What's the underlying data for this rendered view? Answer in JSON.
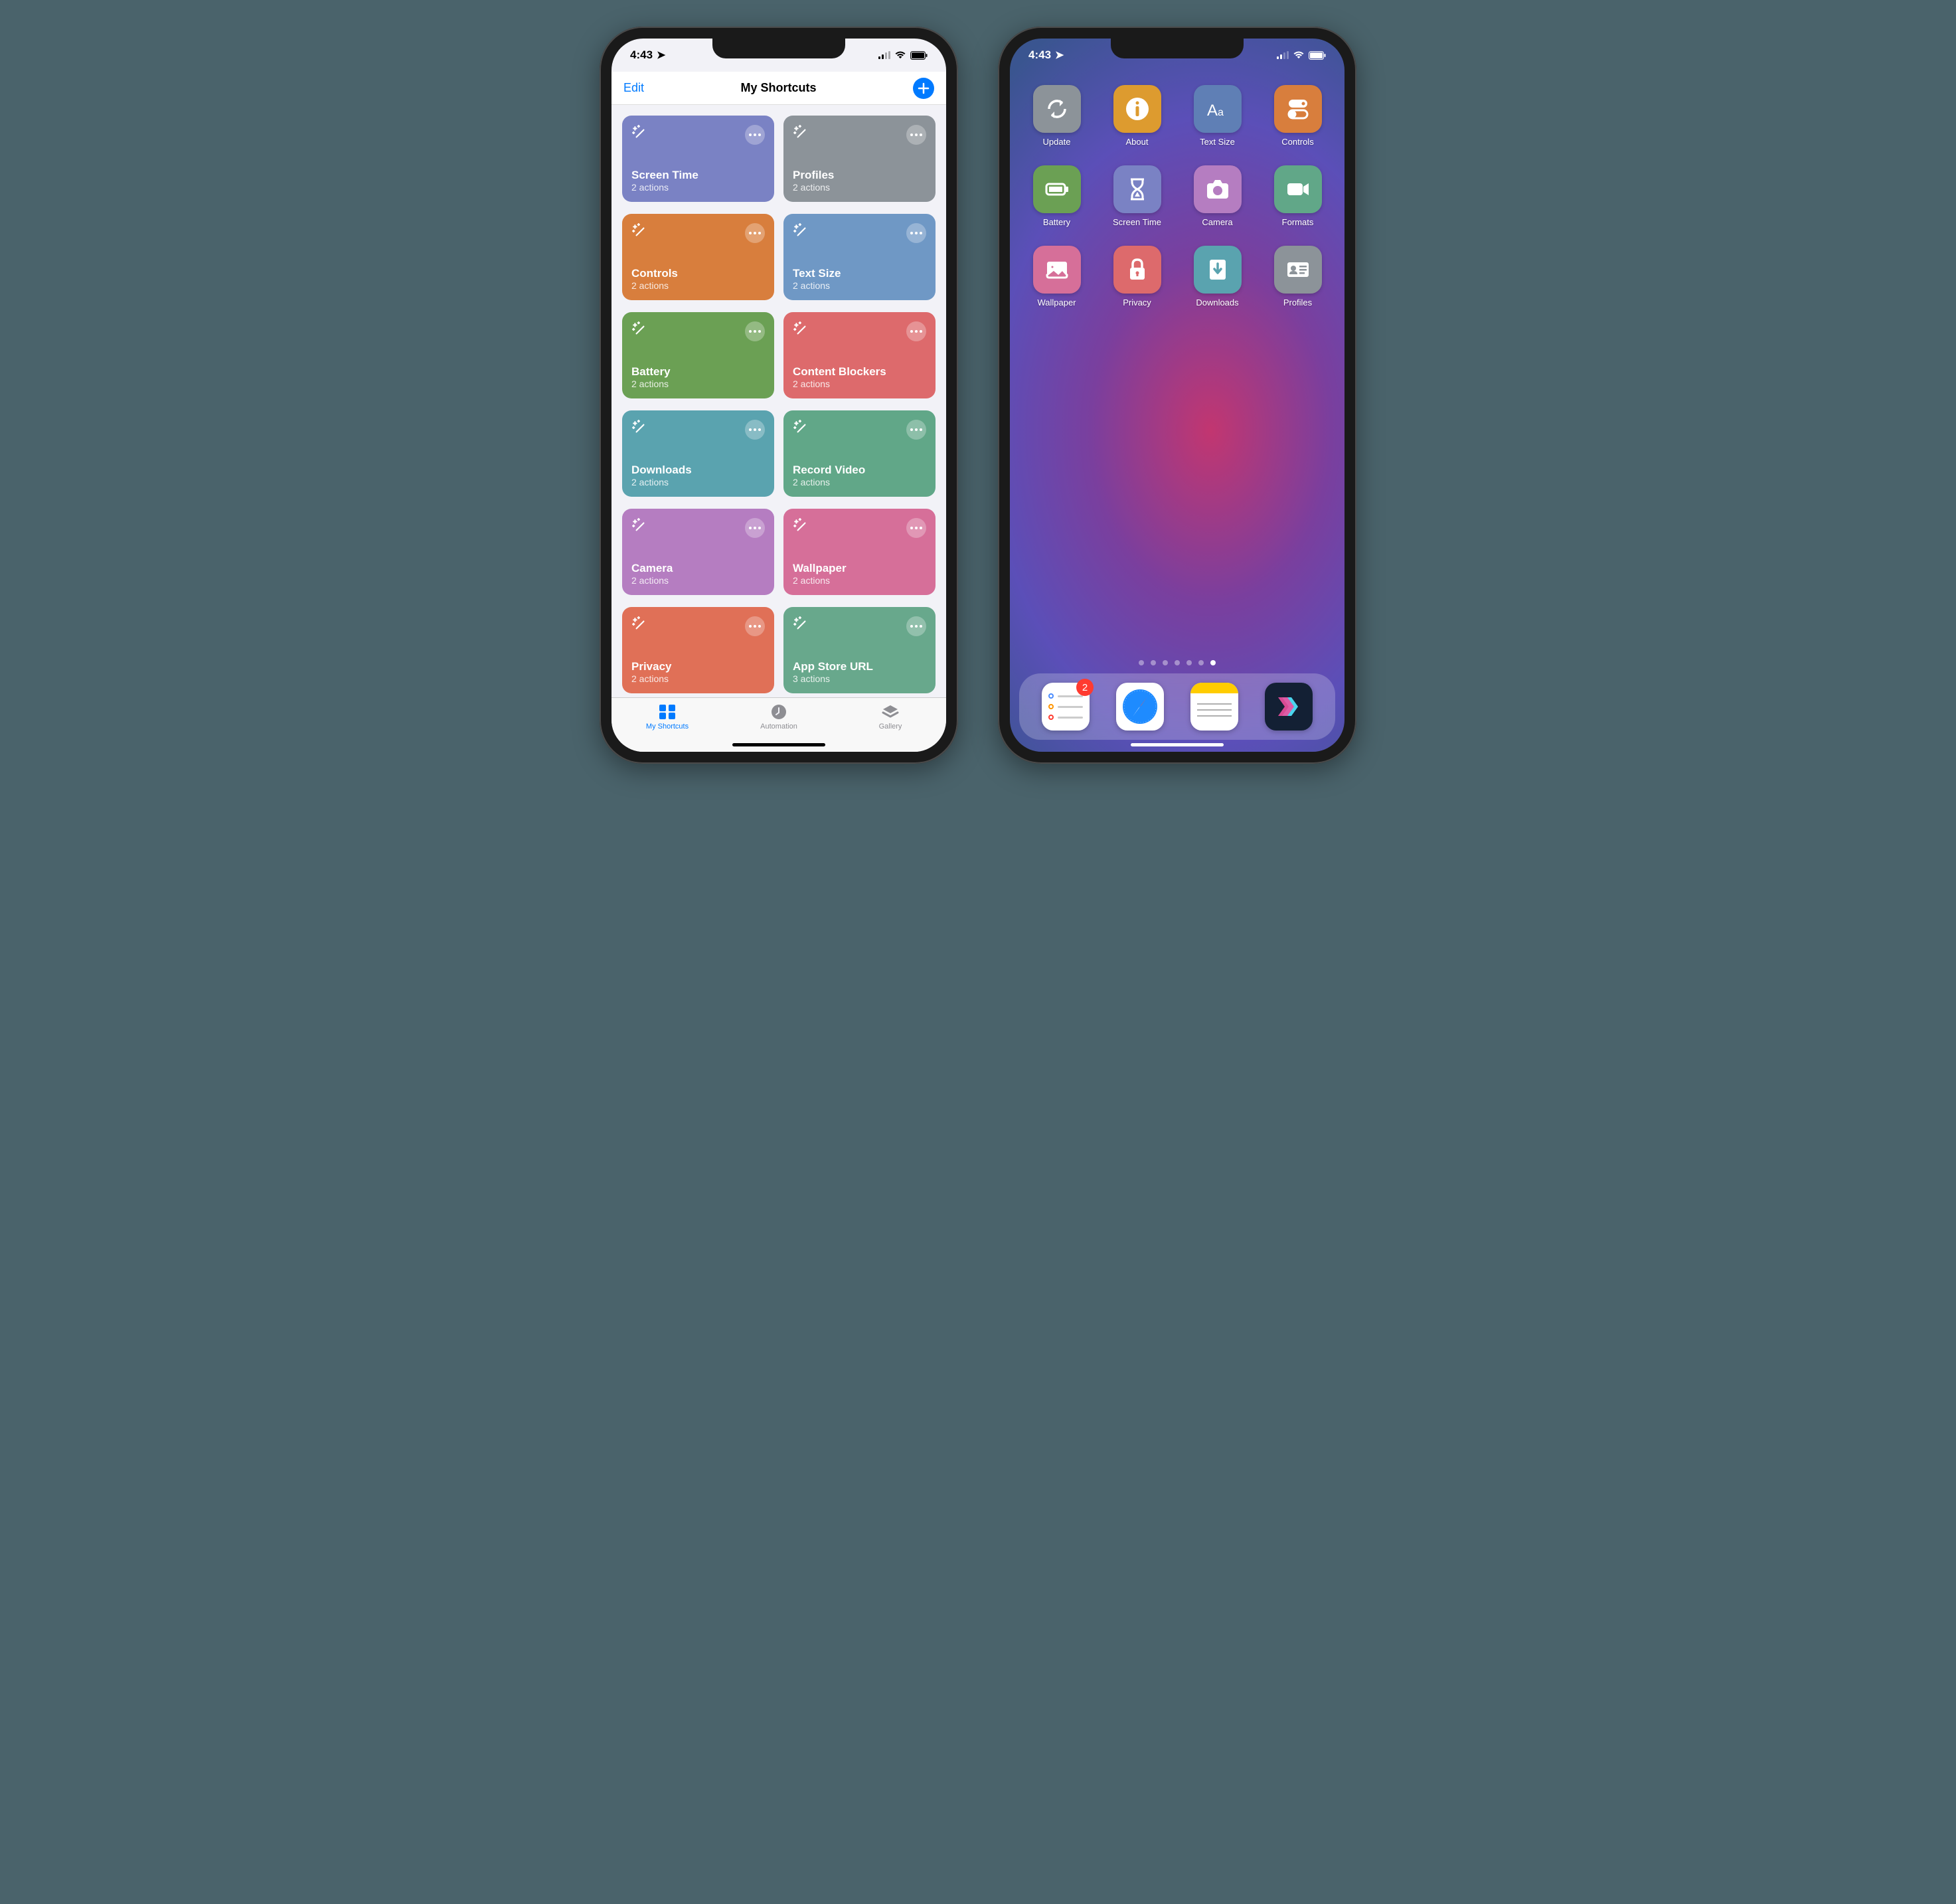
{
  "status": {
    "time": "4:43"
  },
  "shortcuts_app": {
    "nav": {
      "edit": "Edit",
      "title": "My Shortcuts"
    },
    "shortcuts": [
      {
        "name": "Screen Time",
        "actions": "2 actions",
        "color": "#7a82c4"
      },
      {
        "name": "Profiles",
        "actions": "2 actions",
        "color": "#8c9399"
      },
      {
        "name": "Controls",
        "actions": "2 actions",
        "color": "#d87e3d"
      },
      {
        "name": "Text Size",
        "actions": "2 actions",
        "color": "#6f98c5"
      },
      {
        "name": "Battery",
        "actions": "2 actions",
        "color": "#6ba054"
      },
      {
        "name": "Content Blockers",
        "actions": "2 actions",
        "color": "#dd6a6c"
      },
      {
        "name": "Downloads",
        "actions": "2 actions",
        "color": "#5aa3af"
      },
      {
        "name": "Record Video",
        "actions": "2 actions",
        "color": "#61a788"
      },
      {
        "name": "Camera",
        "actions": "2 actions",
        "color": "#b57dc1"
      },
      {
        "name": "Wallpaper",
        "actions": "2 actions",
        "color": "#d66f99"
      },
      {
        "name": "Privacy",
        "actions": "2 actions",
        "color": "#e07057"
      },
      {
        "name": "App Store URL",
        "actions": "3 actions",
        "color": "#68a88c"
      }
    ],
    "tabs": [
      {
        "label": "My Shortcuts",
        "icon": "grid",
        "active": true
      },
      {
        "label": "Automation",
        "icon": "clock",
        "active": false
      },
      {
        "label": "Gallery",
        "icon": "stack",
        "active": false
      }
    ]
  },
  "home_screen": {
    "apps": [
      {
        "label": "Update",
        "icon": "refresh",
        "color": "#8c9399"
      },
      {
        "label": "About",
        "icon": "info",
        "color": "#dd9b2f"
      },
      {
        "label": "Text Size",
        "icon": "textsize",
        "color": "#5f7fb5"
      },
      {
        "label": "Controls",
        "icon": "toggles",
        "color": "#d87e3d"
      },
      {
        "label": "Battery",
        "icon": "battery",
        "color": "#6ba054"
      },
      {
        "label": "Screen Time",
        "icon": "hourglass",
        "color": "#7a82c4"
      },
      {
        "label": "Camera",
        "icon": "camera",
        "color": "#b57dc1"
      },
      {
        "label": "Formats",
        "icon": "video",
        "color": "#61a788"
      },
      {
        "label": "Wallpaper",
        "icon": "image",
        "color": "#d66f99"
      },
      {
        "label": "Privacy",
        "icon": "lock",
        "color": "#dd6a6c"
      },
      {
        "label": "Downloads",
        "icon": "download",
        "color": "#5aa3af"
      },
      {
        "label": "Profiles",
        "icon": "idcard",
        "color": "#8c9399"
      }
    ],
    "dock": [
      {
        "name": "Reminders",
        "badge": "2",
        "type": "reminders"
      },
      {
        "name": "Safari",
        "type": "safari"
      },
      {
        "name": "Notes",
        "type": "notes"
      },
      {
        "name": "Shortcuts",
        "type": "shortcuts"
      }
    ],
    "page_count": 7,
    "active_page": 7
  }
}
